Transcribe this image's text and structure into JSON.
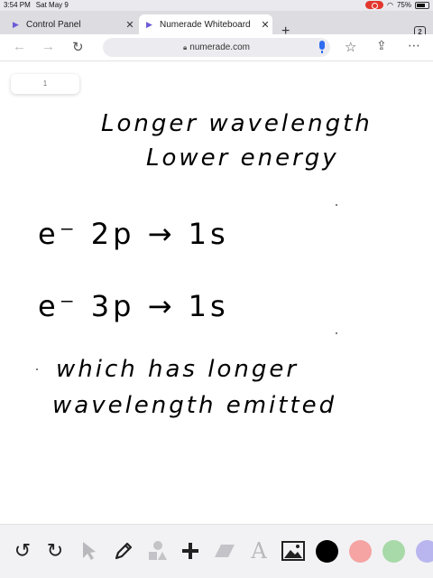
{
  "status_bar": {
    "time": "3:54 PM",
    "date": "Sat May 9",
    "battery": "75%",
    "battery_level": 0.75
  },
  "tabs": [
    {
      "label": "Control Panel",
      "active": false,
      "close": "✕"
    },
    {
      "label": "Numerade Whiteboard",
      "active": true,
      "close": "✕"
    }
  ],
  "new_tab": "+",
  "tab_count": "2",
  "address_bar": {
    "url": "numerade.com"
  },
  "canvas": {
    "page_indicator": "1",
    "lines": [
      "Longer wavelength",
      "Lower energy",
      "e⁻   2p → 1s",
      "e⁻   3p → 1s",
      "which has longer",
      "wavelength emitted"
    ]
  },
  "toolbar": {
    "tools": [
      "undo-icon",
      "redo-icon",
      "pointer-icon",
      "pen-icon",
      "shapes-icon",
      "add-icon",
      "eraser-icon",
      "text-icon",
      "image-icon"
    ],
    "text_tool": "A",
    "colors": [
      "#000000",
      "#f5a3a3",
      "#a8d9a8",
      "#b9b6ef"
    ]
  }
}
